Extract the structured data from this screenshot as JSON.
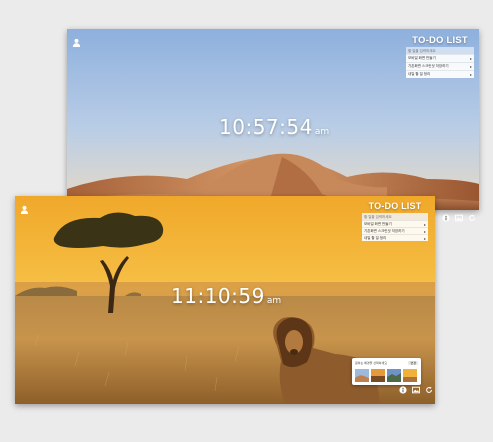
{
  "back_screen": {
    "clock": {
      "time": "10:57:54",
      "ampm": "am"
    },
    "todo": {
      "title": "TO-DO LIST",
      "input_placeholder": "할 일을 입력하세요",
      "items": [
        {
          "text": "모바일 화면 만들기"
        },
        {
          "text": "기존화면 스크린샷 저장하기"
        },
        {
          "text": "내일 할 일 정리"
        }
      ]
    }
  },
  "front_screen": {
    "clock": {
      "time": "11:10:59",
      "ampm": "am"
    },
    "todo": {
      "title": "TO-DO LIST",
      "input_placeholder": "할 일을 입력하세요",
      "items": [
        {
          "text": "모바일 화면 만들기"
        },
        {
          "text": "기존화면 스크린샷 저장하기"
        },
        {
          "text": "내일 할 일 정리"
        }
      ]
    },
    "bg_popup": {
      "title": "원하는 배경을 선택하세요",
      "button": "변경"
    }
  },
  "icons": {
    "user": "user-icon",
    "todo_toggle": "info-icon",
    "background": "image-icon",
    "refresh": "refresh-icon"
  },
  "colors": {
    "accent_white": "#ffffff",
    "desert_sky": "#a9c4e2",
    "savanna_sky": "#f3b733"
  }
}
